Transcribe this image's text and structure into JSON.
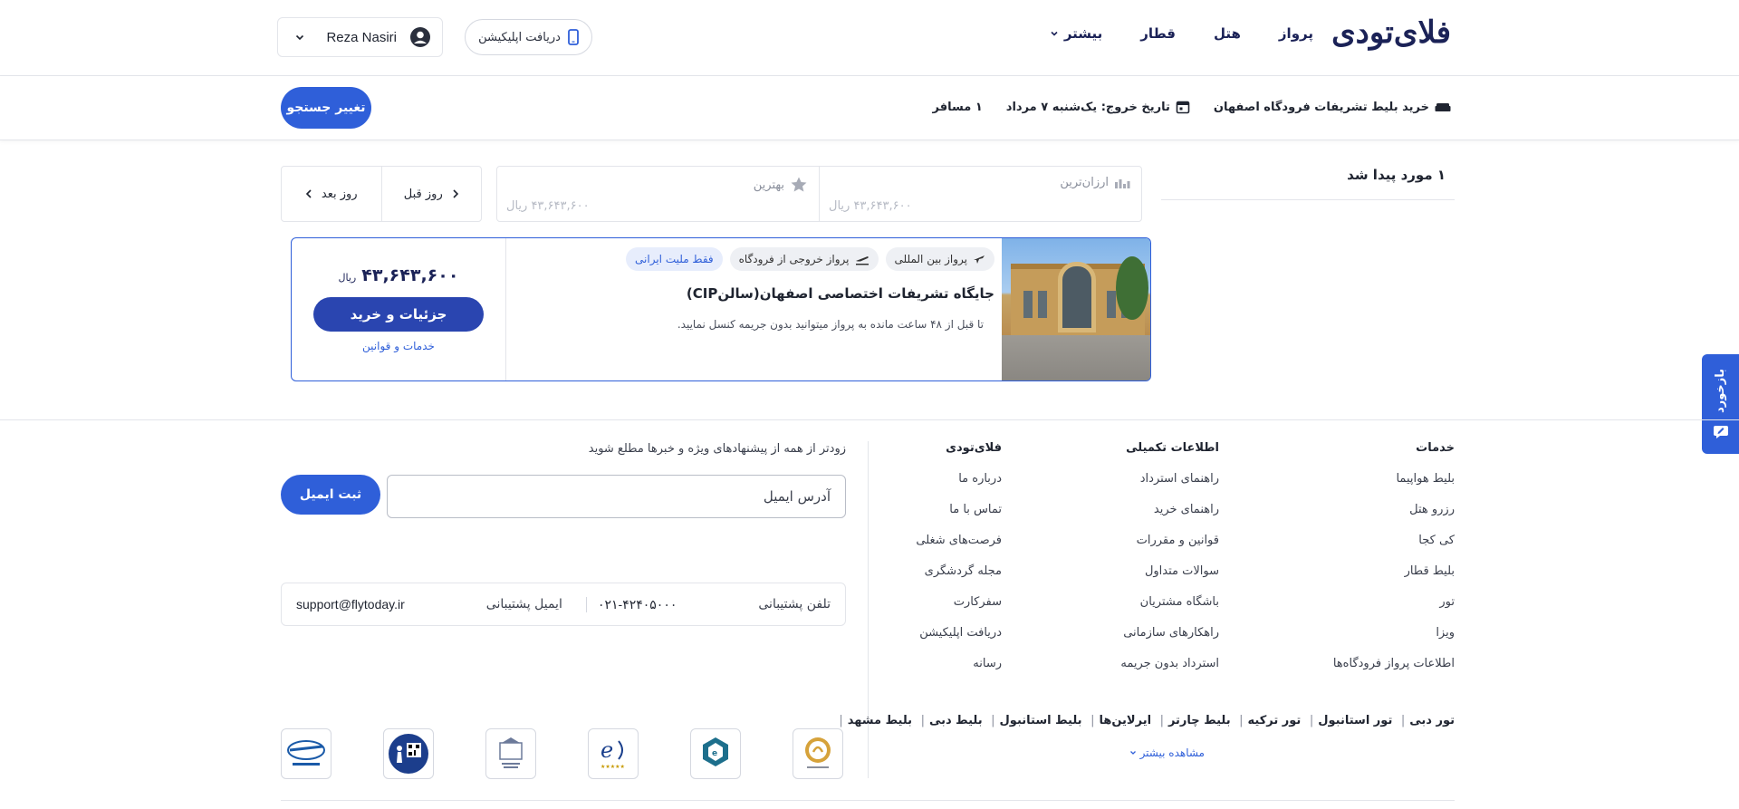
{
  "header": {
    "logo": "فلای‌تودی",
    "nav": [
      "پرواز",
      "هتل",
      "قطار",
      "بیشتر"
    ],
    "app_button": "دریافت اپلیکیشن",
    "user_name": "Reza Nasiri"
  },
  "summary": {
    "service": "خرید بلیط تشریفات فرودگاه اصفهان",
    "date": "تاریخ خروج: یک‌شنبه ۷ مرداد",
    "passengers": "۱ مسافر",
    "change_button": "تغییر جستجو"
  },
  "results": {
    "found_text": "۱ مورد پیدا شد",
    "sort": {
      "cheapest_label": "ارزان‌ترین",
      "cheapest_price": "۴۳,۶۴۳,۶۰۰ ریال",
      "best_label": "بهترین",
      "best_price": "۴۳,۶۴۳,۶۰۰ ریال"
    },
    "prev_day": "روز قبل",
    "next_day": "روز بعد"
  },
  "card": {
    "tags": [
      "پرواز بین المللی",
      "پرواز خروجی از فرودگاه",
      "فقط ملیت ایرانی"
    ],
    "title": "جایگاه تشریفات اختصاصی اصفهان(سالنCIP)",
    "description": "تا قبل از ۴۸ ساعت مانده به پرواز میتوانید بدون جریمه کنسل نمایید.",
    "price": "۴۳,۶۴۳,۶۰۰",
    "currency": "ریال",
    "buy_button": "جزئیات و خرید",
    "rules_link": "خدمات و قوانین"
  },
  "feedback": "بازخورد",
  "footer": {
    "services": {
      "title": "خدمات",
      "items": [
        "بلیط هواپیما",
        "رزرو هتل",
        "کی کجا",
        "بلیط قطار",
        "تور",
        "ویزا",
        "اطلاعات پرواز فرودگاه‌ها"
      ]
    },
    "info": {
      "title": "اطلاعات تکمیلی",
      "items": [
        "راهنمای استرداد",
        "راهنمای خرید",
        "قوانین و مقررات",
        "سوالات متداول",
        "باشگاه مشتریان",
        "راهکارهای سازمانی",
        "استرداد بدون جریمه"
      ]
    },
    "flytoday": {
      "title": "فلای‌تودی",
      "items": [
        "درباره ما",
        "تماس با ما",
        "فرصت‌های شغلی",
        "مجله گردشگری",
        "سفرکارت",
        "دریافت اپلیکیشن",
        "رسانه"
      ]
    },
    "newsletter_text": "زودتر از همه از پیشنهادهای ویژه و خبرها مطلع شوید",
    "email_placeholder": "آدرس ایمیل",
    "email_button": "ثبت ایمیل",
    "support_phone_label": "تلفن پشتیبانی",
    "support_phone": "۰۲۱-۴۲۴۰۵۰۰۰",
    "support_email_label": "ایمیل پشتیبانی",
    "support_email": "support@flytoday.ir",
    "popular_links": [
      "تور دبی",
      "تور استانبول",
      "تور ترکیه",
      "بلیط چارتر",
      "ایرلاین‌ها",
      "بلیط استانبول",
      "بلیط دبی",
      "بلیط مشهد"
    ],
    "more_link": "مشاهده بیشتر",
    "badges": [
      "airline-association-badge",
      "passenger-rights-badge",
      "cao-badge",
      "enamad-badge",
      "ecommerce-union-badge",
      "samandehi-badge"
    ]
  },
  "colors": {
    "primary": "#2f5fd9",
    "dark_blue": "#1b2257",
    "buy_button": "#2a45b0",
    "border": "#e3e5ea"
  }
}
